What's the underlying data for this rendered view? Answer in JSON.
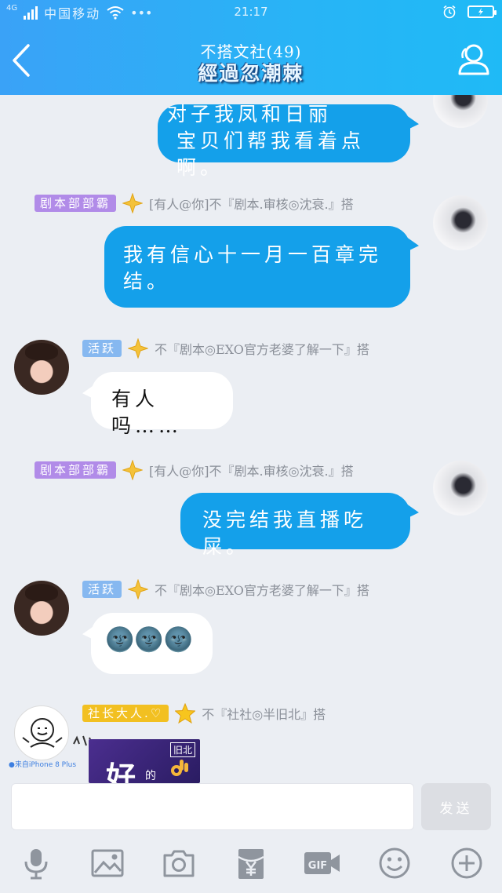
{
  "status_bar": {
    "network": "4G",
    "carrier": "中国移动",
    "extra": "•••",
    "time": "21:17",
    "battery_icon": "battery-charging-icon",
    "alarm_icon": "alarm-icon"
  },
  "header": {
    "title": "不搭文社(49)",
    "subtitle": "經過忽潮棘",
    "back_icon": "chevron-left-icon",
    "members_icon": "group-members-icon"
  },
  "messages": [
    {
      "side": "right",
      "text_line1": "对子我凤和日丽",
      "text_line2": "宝贝们帮我看着点啊。"
    },
    {
      "side": "right",
      "badge": "剧本部部霸",
      "meta": "[有人@你]不『剧本.审核◎沈衰.』搭",
      "text": "我有信心十一月一百章完结。"
    },
    {
      "side": "left",
      "badge": "活跃",
      "meta": "不『剧本◎EXO官方老婆了解一下』搭",
      "text": "有人吗……"
    },
    {
      "side": "right",
      "badge": "剧本部部霸",
      "meta": "[有人@你]不『剧本.审核◎沈衰.』搭",
      "text": "没完结我直播吃屎。"
    },
    {
      "side": "left",
      "badge": "活跃",
      "meta": "不『剧本◎EXO官方老婆了解一下』搭",
      "emojis": [
        "🌚",
        "🌚",
        "🌚"
      ]
    },
    {
      "side": "left",
      "badge": "社长大人.♡",
      "meta": "不『社社◎半旧北』搭",
      "location": "来自iPhone 8 Plus",
      "sticker_text": "好",
      "sticker_small": "的",
      "sticker_corner": "旧北"
    }
  ],
  "input": {
    "placeholder": "",
    "send_label": "发送"
  },
  "toolbar": [
    "microphone-icon",
    "image-icon",
    "camera-icon",
    "red-packet-icon",
    "gif-icon",
    "emoji-icon",
    "plus-icon"
  ],
  "colors": {
    "header": "#28b4f6",
    "my_bubble": "#14a0ea",
    "their_bubble": "#ffffff",
    "background": "#ebeef3"
  }
}
